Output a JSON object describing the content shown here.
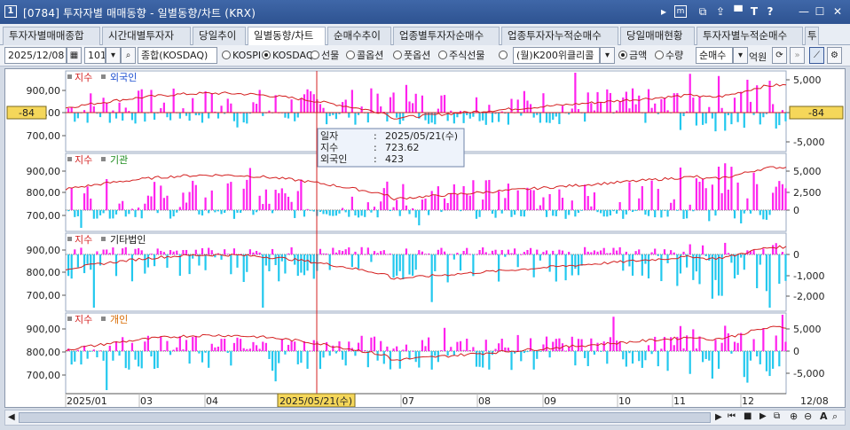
{
  "window": {
    "number": "1",
    "title": "[0784] 투자자별 매매동향 - 일별동향/차트 (KRX)",
    "controls": [
      "▸",
      "m",
      "⧉",
      "⇪",
      "▀",
      "T",
      "?",
      "—",
      "☐",
      "✕"
    ]
  },
  "tabs": [
    {
      "label": "투자자별매매종합",
      "active": false
    },
    {
      "label": "시간대별투자자",
      "active": false
    },
    {
      "label": "당일추이",
      "active": false
    },
    {
      "label": "일별동향/차트",
      "active": true
    },
    {
      "label": "순매수추이",
      "active": false
    },
    {
      "label": "업종별투자자순매수",
      "active": false
    },
    {
      "label": "업종투자자누적순매수",
      "active": false
    },
    {
      "label": "당일매매현황",
      "active": false
    },
    {
      "label": "투자자별누적순매수",
      "active": false
    },
    {
      "label": "투",
      "active": false
    }
  ],
  "toolbar": {
    "date": "2025/12/08",
    "code": "101",
    "market": "종합(KOSDAQ)",
    "radios": [
      {
        "label": "KOSPI",
        "checked": false
      },
      {
        "label": "KOSDAQ",
        "checked": true
      },
      {
        "label": "선물",
        "checked": false
      },
      {
        "label": "콜옵션",
        "checked": false
      },
      {
        "label": "풋옵션",
        "checked": false
      },
      {
        "label": "주식선물",
        "checked": false
      },
      {
        "label": "",
        "checked": false
      }
    ],
    "product": "(월)K200위클리콜",
    "unit_radios": [
      {
        "label": "금액",
        "checked": true
      },
      {
        "label": "수량",
        "checked": false
      }
    ],
    "type": "순매수",
    "unit": "억원"
  },
  "panels": [
    {
      "index_label": "지수",
      "investor": "외국인",
      "investor_color": "#1d4fd0",
      "left_ticks": [
        "900,00",
        "800,00",
        "700,00"
      ],
      "right_ticks": [
        "5,000",
        "0",
        "-5,000"
      ],
      "value_badge": "-84"
    },
    {
      "index_label": "지수",
      "investor": "기관",
      "investor_color": "#1a8a1a",
      "left_ticks": [
        "900,00",
        "800,00",
        "700,00"
      ],
      "right_ticks": [
        "5,000",
        "2,500",
        "0"
      ]
    },
    {
      "index_label": "지수",
      "investor": "기타법인",
      "investor_color": "#111111",
      "left_ticks": [
        "900,00",
        "800,00",
        "700,00"
      ],
      "right_ticks": [
        "0",
        "-1,000",
        "-2,000"
      ]
    },
    {
      "index_label": "지수",
      "investor": "개인",
      "investor_color": "#d86a00",
      "left_ticks": [
        "900,00",
        "800,00",
        "700,00"
      ],
      "right_ticks": [
        "5,000",
        "0",
        "-5,000"
      ]
    }
  ],
  "x_axis": {
    "labels": [
      "2025/01",
      "03",
      "04",
      "07",
      "08",
      "09",
      "10",
      "11",
      "12"
    ],
    "cursor_label": "2025/05/21(수)",
    "end_label": "12/08"
  },
  "tooltip": {
    "rows": [
      {
        "key": "일자",
        "value": "2025/05/21(수)"
      },
      {
        "key": "지수",
        "value": "723.62"
      },
      {
        "key": "외국인",
        "value": "423"
      }
    ]
  },
  "colors": {
    "positive_bar": "#ff22ee",
    "negative_bar": "#22c8ee",
    "index_line": "#d42020",
    "cursor": "#d42020",
    "badge": "#f5d75a"
  }
}
